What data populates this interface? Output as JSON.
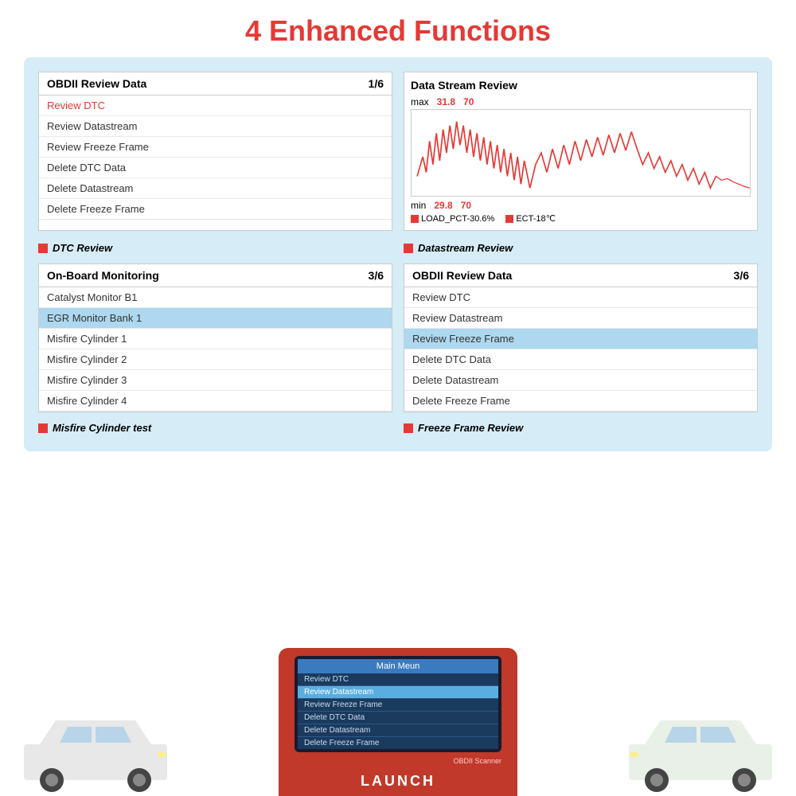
{
  "page": {
    "title_plain": "4 Enhanced ",
    "title_red": "Functions"
  },
  "panel1": {
    "title": "OBDII Review Data",
    "page": "1/6",
    "rows": [
      {
        "text": "Review DTC",
        "highlighted": false,
        "red": true
      },
      {
        "text": "Review Datastream",
        "highlighted": false,
        "red": false
      },
      {
        "text": "Review Freeze Frame",
        "highlighted": false,
        "red": false
      },
      {
        "text": "Delete DTC Data",
        "highlighted": false,
        "red": false
      },
      {
        "text": "Delete Datastream",
        "highlighted": false,
        "red": false
      },
      {
        "text": "Delete Freeze Frame",
        "highlighted": false,
        "red": false
      }
    ],
    "label": "DTC Review"
  },
  "panel2": {
    "title": "Data Stream Review",
    "max_label": "max",
    "max_val1": "31.8",
    "max_val2": "70",
    "min_label": "min",
    "min_val1": "29.8",
    "min_val2": "70",
    "legend1": "LOAD_PCT-30.6%",
    "legend2": "ECT-18℃",
    "label": "Datastream Review"
  },
  "panel3": {
    "title": "On-Board Monitoring",
    "page": "3/6",
    "rows": [
      {
        "text": "Catalyst Monitor B1",
        "highlighted": false
      },
      {
        "text": "EGR Monitor Bank 1",
        "highlighted": true
      },
      {
        "text": "Misfire Cylinder 1",
        "highlighted": false
      },
      {
        "text": "Misfire Cylinder 2",
        "highlighted": false
      },
      {
        "text": "Misfire Cylinder 3",
        "highlighted": false
      },
      {
        "text": "Misfire Cylinder 4",
        "highlighted": false
      }
    ],
    "label": "Misfire Cylinder test"
  },
  "panel4": {
    "title": "OBDII Review Data",
    "page": "3/6",
    "rows": [
      {
        "text": "Review DTC",
        "highlighted": false
      },
      {
        "text": "Review Datastream",
        "highlighted": false
      },
      {
        "text": "Review Freeze Frame",
        "highlighted": true
      },
      {
        "text": "Delete DTC Data",
        "highlighted": false
      },
      {
        "text": "Delete Datastream",
        "highlighted": false
      },
      {
        "text": "Delete Freeze Frame",
        "highlighted": false
      }
    ],
    "label": "Freeze Frame Review"
  },
  "device": {
    "menu_title": "Main Meun",
    "menu_rows": [
      {
        "text": "Review DTC",
        "active": false
      },
      {
        "text": "Review Datastream",
        "active": true
      },
      {
        "text": "Review Freeze Frame",
        "active": false
      },
      {
        "text": "Delete DTC Data",
        "active": false
      },
      {
        "text": "Delete Datastream",
        "active": false
      },
      {
        "text": "Delete Freeze Frame",
        "active": false
      }
    ],
    "scanner_label": "OBDII Scanner",
    "brand": "LAUNCH"
  }
}
